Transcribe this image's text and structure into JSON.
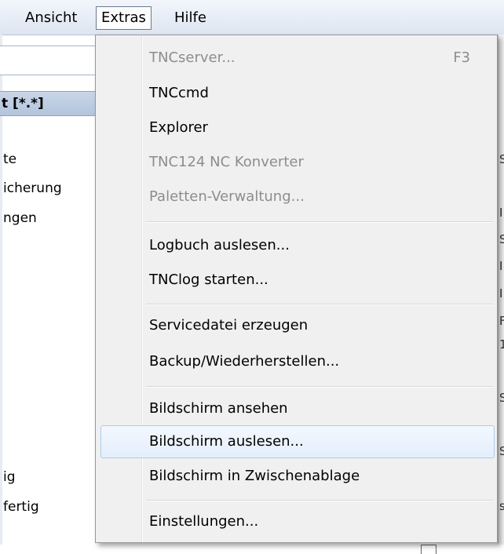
{
  "menubar": {
    "items": [
      {
        "label": "Ansicht"
      },
      {
        "label": "Extras",
        "active": true
      },
      {
        "label": "Hilfe"
      }
    ]
  },
  "background": {
    "header_label": "t [*.*]",
    "items": [
      "te",
      "icherung",
      "ngen",
      "ig",
      "fertig"
    ],
    "right_chars": [
      "S",
      "I",
      "S",
      "I",
      "I",
      "F",
      "1",
      "S",
      "S",
      "s"
    ]
  },
  "extras_menu": {
    "items": [
      {
        "label": "TNCserver...",
        "shortcut": "F3",
        "enabled": false
      },
      {
        "label": "TNCcmd",
        "enabled": true
      },
      {
        "label": "Explorer",
        "enabled": true
      },
      {
        "label": "TNC124 NC Konverter",
        "enabled": false
      },
      {
        "label": "Paletten-Verwaltung...",
        "enabled": false
      },
      {
        "label": "Logbuch auslesen...",
        "enabled": true
      },
      {
        "label": "TNClog starten...",
        "enabled": true
      },
      {
        "label": "Servicedatei erzeugen",
        "enabled": true
      },
      {
        "label": "Backup/Wiederherstellen...",
        "enabled": true
      },
      {
        "label": "Bildschirm ansehen",
        "enabled": true
      },
      {
        "label": "Bildschirm auslesen...",
        "enabled": true,
        "highlighted": true
      },
      {
        "label": "Bildschirm in Zwischenablage",
        "enabled": true
      },
      {
        "label": "Einstellungen...",
        "enabled": true
      }
    ]
  },
  "colors": {
    "disabled_text": "#8d8d8d",
    "highlight_border": "#aecbee",
    "menu_background": "#f0f0f0"
  }
}
